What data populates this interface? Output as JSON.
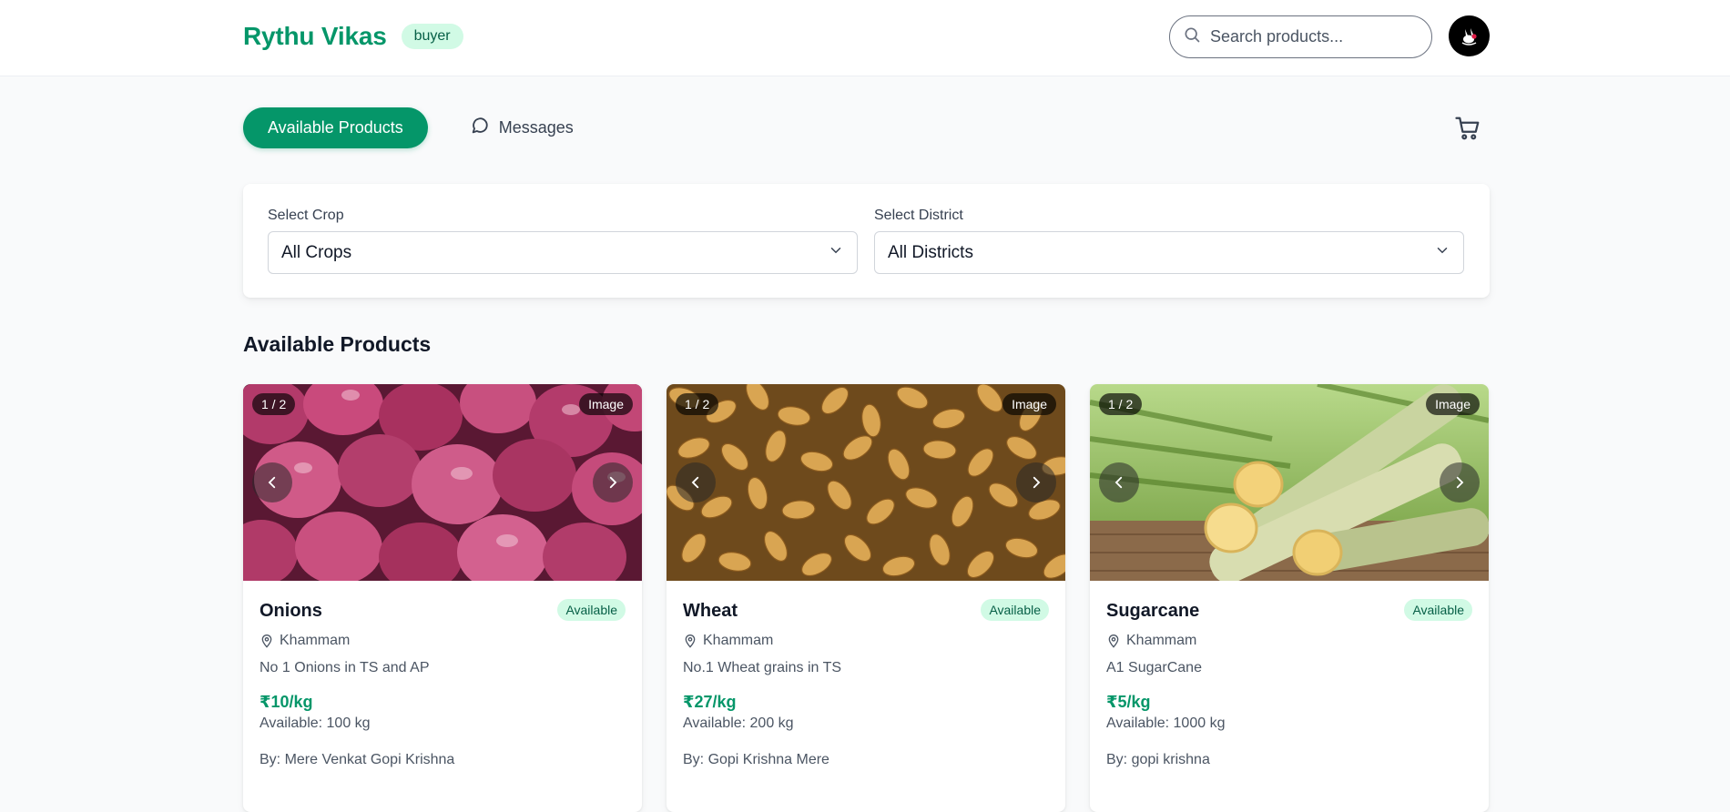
{
  "header": {
    "brand": "Rythu Vikas",
    "role": "buyer",
    "search_placeholder": "Search products..."
  },
  "tabs": [
    {
      "label": "Available Products",
      "active": true
    },
    {
      "label": "Messages",
      "active": false
    }
  ],
  "filters": {
    "crop": {
      "label": "Select Crop",
      "value": "All Crops"
    },
    "district": {
      "label": "Select District",
      "value": "All Districts"
    }
  },
  "section_title": "Available Products",
  "colors": {
    "accent": "#059669",
    "badge_bg": "#d1fae5"
  },
  "products": [
    {
      "image_counter": "1 / 2",
      "image_label": "Image",
      "name": "Onions",
      "status": "Available",
      "location": "Khammam",
      "description": "No 1 Onions in TS and AP",
      "price": "₹10/kg",
      "available": "Available: 100 kg",
      "seller": "By: Mere Venkat Gopi Krishna"
    },
    {
      "image_counter": "1 / 2",
      "image_label": "Image",
      "name": "Wheat",
      "status": "Available",
      "location": "Khammam",
      "description": "No.1 Wheat grains in TS",
      "price": "₹27/kg",
      "available": "Available: 200 kg",
      "seller": "By: Gopi Krishna Mere"
    },
    {
      "image_counter": "1 / 2",
      "image_label": "Image",
      "name": "Sugarcane",
      "status": "Available",
      "location": "Khammam",
      "description": "A1 SugarCane",
      "price": "₹5/kg",
      "available": "Available: 1000 kg",
      "seller": "By: gopi krishna"
    }
  ]
}
